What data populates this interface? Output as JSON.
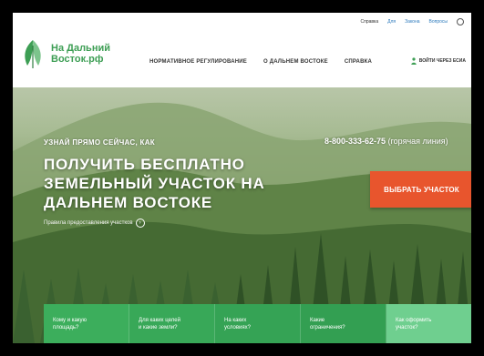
{
  "utility_bar": {
    "links": [
      "Справка",
      "Для",
      "Закона",
      "Вопросы"
    ]
  },
  "logo": {
    "line1": "На Дальний",
    "line2": "Восток.рф"
  },
  "nav": {
    "items": [
      "НОРМАТИВНОЕ РЕГУЛИРОВАНИЕ",
      "О ДАЛЬНЕМ ВОСТОКЕ",
      "СПРАВКА"
    ]
  },
  "login": {
    "label": "ВОЙТИ ЧЕРЕЗ ЕСИА"
  },
  "hero": {
    "pre_title": "УЗНАЙ ПРЯМО СЕЙЧАС, КАК",
    "title": "ПОЛУЧИТЬ БЕСПЛАТНО ЗЕМЕЛЬНЫЙ УЧАСТОК НА ДАЛЬНЕМ ВОСТОКЕ",
    "subtitle": "Правила предоставления участков",
    "phone": "8-800-333-62-75",
    "phone_note": "(горячая линия)",
    "cta": "ВЫБРАТЬ УЧАСТОК"
  },
  "tabs": [
    {
      "line1": "Кому и какую",
      "line2": "площадь?"
    },
    {
      "line1": "Для каких целей",
      "line2": "и какие земли?"
    },
    {
      "line1": "На каких",
      "line2": "условиях?"
    },
    {
      "line1": "Какие",
      "line2": "ограничения?"
    },
    {
      "line1": "Как оформить",
      "line2": "участок?"
    }
  ],
  "colors": {
    "brand_green": "#3d9e54",
    "tab_green": "#3cae5c",
    "tab_active": "#6fcf8f",
    "cta_orange": "#e8552d"
  }
}
